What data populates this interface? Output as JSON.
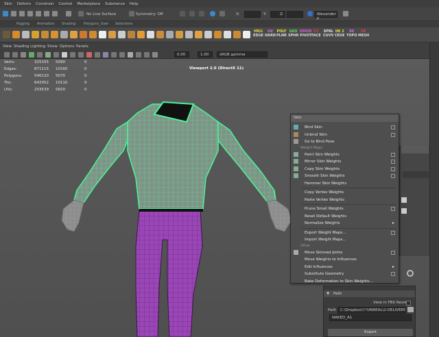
{
  "menubar": {
    "items": [
      "Skin",
      "Deform",
      "Constrain",
      "Control",
      "Marketplace",
      "Substance",
      "Help"
    ]
  },
  "statusline": {
    "uv_surface": "No Live Surface",
    "symmetry": "Symmetry: Off",
    "x_label": "X:",
    "y_label": "Y:",
    "z_label": "Z:",
    "user": "Alexander P"
  },
  "shelf_tabs": [
    "Rigging",
    "Animation",
    "Shading",
    "Polygons_User",
    "Selections"
  ],
  "shelf_tags": [
    {
      "top": "MRG",
      "bot": "EDGE",
      "color": "#e0d040"
    },
    {
      "top": "UV",
      "bot": "HARD",
      "color": "#d070e0"
    },
    {
      "top": "POLY",
      "bot": "PLNR",
      "color": "#e0e040"
    },
    {
      "top": "GEO",
      "bot": "SPHR",
      "color": "#60e060"
    },
    {
      "top": "DMOD",
      "bot": "PIVOT",
      "color": "#d060d0"
    },
    {
      "top": "DT",
      "bot": "FACE",
      "color": "#d04040"
    },
    {
      "top": "SPRL",
      "bot": "CUVV",
      "color": "#e0e0e0"
    },
    {
      "top": "HE 2",
      "bot": "CRSE",
      "color": "#e0e040"
    },
    {
      "top": "RE",
      "bot": "TOPO",
      "color": "#d070e0"
    },
    {
      "top": "RE",
      "bot": "MESH",
      "color": "#e04040"
    }
  ],
  "panel_menu": [
    "View",
    "Shading",
    "Lighting",
    "Show",
    "Options",
    "Panels"
  ],
  "panel_toolbar": {
    "exposure": "0.00",
    "gamma": "1.00",
    "color_space": "sRGB gamma"
  },
  "viewport": {
    "title": "Viewport 2.0 (DirectX 11)",
    "hud": [
      {
        "label": "Verts:",
        "a": "325155",
        "b": "5090",
        "c": "0"
      },
      {
        "label": "Edges:",
        "a": "871115",
        "b": "10160",
        "c": "0"
      },
      {
        "label": "Polygons:",
        "a": "546120",
        "b": "5070",
        "c": "0"
      },
      {
        "label": "Tris:",
        "a": "642052",
        "b": "10110",
        "c": "0"
      },
      {
        "label": "UVs:",
        "a": "203539",
        "b": "5820",
        "c": "0"
      }
    ]
  },
  "skin_menu": {
    "title": "Skin",
    "items": [
      {
        "label": "Bind Skin",
        "opt": true
      },
      {
        "label": "Unbind Skin",
        "opt": true
      },
      {
        "label": "Go to Bind Pose",
        "opt": false
      }
    ],
    "section_weight_maps": "Weight Maps",
    "weight_items": [
      {
        "label": "Paint Skin Weights",
        "opt": true
      },
      {
        "label": "Mirror Skin Weights",
        "opt": true
      },
      {
        "label": "Copy Skin Weights",
        "opt": true
      },
      {
        "label": "Smooth Skin Weights",
        "opt": true
      },
      {
        "label": "Hammer Skin Weights",
        "opt": false
      }
    ],
    "vertex_items": [
      {
        "label": "Copy Vertex Weights",
        "opt": false
      },
      {
        "label": "Paste Vertex Weights",
        "opt": false
      }
    ],
    "prune_items": [
      {
        "label": "Prune Small Weights",
        "opt": true
      },
      {
        "label": "Reset Default Weights",
        "opt": false
      },
      {
        "label": "Normalize Weights",
        "sub": true
      }
    ],
    "export_items": [
      {
        "label": "Export Weight Maps...",
        "opt": true
      },
      {
        "label": "Import Weight Maps...",
        "opt": false
      }
    ],
    "section_other": "Other",
    "other_items": [
      {
        "label": "Move Skinned Joints",
        "opt": true
      },
      {
        "label": "Move Weights to Influences",
        "opt": false
      },
      {
        "label": "Edit Influences",
        "sub": true
      },
      {
        "label": "Substitute Geometry",
        "opt": true
      },
      {
        "label": "Bake Deformation to Skin Weights...",
        "opt": false
      }
    ]
  },
  "bottom_panel": {
    "section": "Path",
    "review_label": "View in FBX Review",
    "path_label": "Path",
    "path_value": "C:\\Dropbox\\!!!UNREAL\\2-DELIVERY...",
    "name_value": "NAKED_A1",
    "export_label": "Export"
  },
  "colors": {
    "shirt_fill": "#7f9487",
    "shirt_wire": "#4cf59a",
    "pants": "#9a46b6",
    "pants_dark": "#5e2371",
    "skin": "#8d8d8d"
  }
}
